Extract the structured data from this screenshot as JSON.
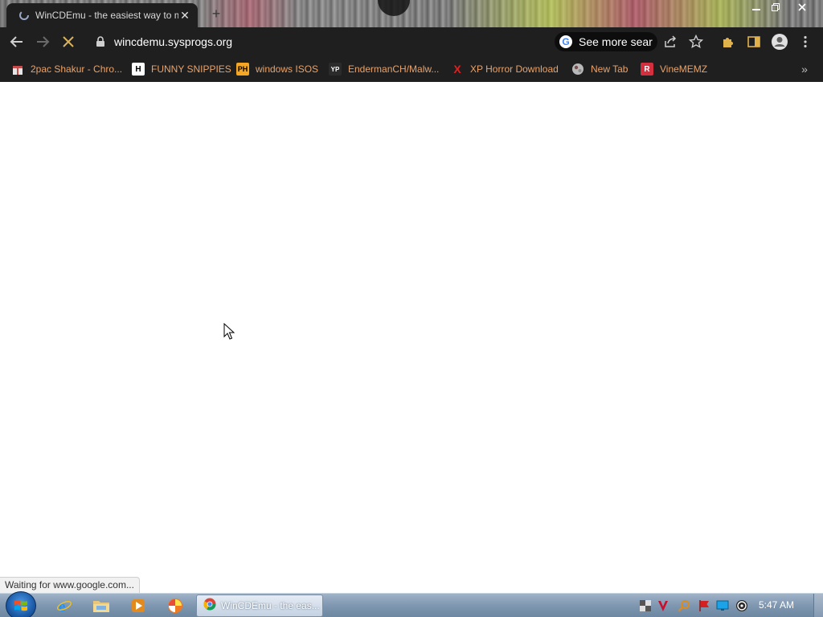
{
  "browser": {
    "tab": {
      "title": "WinCDEmu - the easiest way to m",
      "close_glyph": "✕"
    },
    "new_tab_glyph": "+",
    "window_controls": {
      "minimize": "minimize-icon",
      "maximize": "restore-icon",
      "close": "close-icon"
    },
    "toolbar": {
      "back": "back-arrow-icon",
      "forward": "forward-arrow-icon",
      "reload": "stop-loading-icon",
      "url": "wincdemu.sysprogs.org",
      "search_chip": {
        "google_letter": "G",
        "label": "See more sear"
      },
      "share": "share-icon",
      "bookmark": "star-icon",
      "extensions": "puzzle-icon",
      "side_panel": "side-panel-icon",
      "profile": "profile-icon",
      "menu": "kebab-menu-icon"
    },
    "bookmarks": [
      {
        "label": "2pac Shakur - Chro...",
        "icon": "gift-icon",
        "icon_text": ""
      },
      {
        "label": "FUNNY SNIPPIES",
        "icon": "h-icon",
        "icon_text": "H"
      },
      {
        "label": "windows ISOS",
        "icon": "ph-icon",
        "icon_text": "PH"
      },
      {
        "label": "EndermanCH/Malw...",
        "icon": "yp-icon",
        "icon_text": "YP"
      },
      {
        "label": "XP Horror Download",
        "icon": "x-icon",
        "icon_text": "X"
      },
      {
        "label": "New Tab",
        "icon": "globe-icon",
        "icon_text": ""
      },
      {
        "label": "VineMEMZ",
        "icon": "r-icon",
        "icon_text": "R"
      }
    ],
    "bookmarks_more": "»",
    "status": "Waiting for www.google.com..."
  },
  "taskbar": {
    "start": "windows-orb-icon",
    "pinned": [
      "internet-explorer-icon",
      "file-explorer-icon",
      "media-player-icon",
      "pinwheel-app-icon"
    ],
    "active_window": {
      "icon": "chrome-icon",
      "label": "WinCDEmu - the eas..."
    },
    "tray": [
      "chess-icon",
      "v-logo-icon",
      "search-tray-icon",
      "flag-icon",
      "monitor-icon",
      "disc-icon"
    ],
    "clock": "5:47 AM"
  },
  "colors": {
    "chrome_dark": "#1f1f1f",
    "bookmark_text": "#e9a36a",
    "taskbar": "#7f97b0"
  }
}
